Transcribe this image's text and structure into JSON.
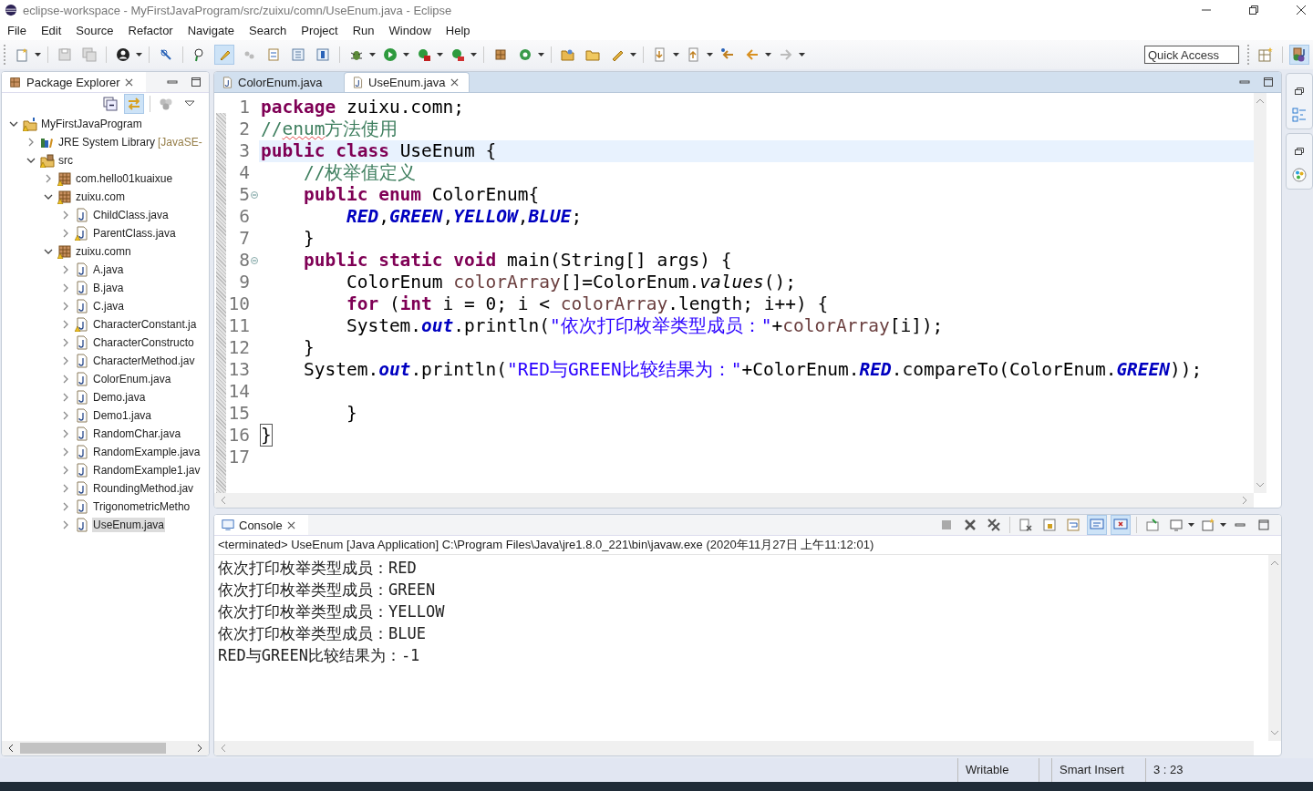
{
  "window": {
    "title": "eclipse-workspace - MyFirstJavaProgram/src/zuixu/comn/UseEnum.java - Eclipse"
  },
  "menu": [
    "File",
    "Edit",
    "Source",
    "Refactor",
    "Navigate",
    "Search",
    "Project",
    "Run",
    "Window",
    "Help"
  ],
  "quick_access": {
    "placeholder": "Quick Access"
  },
  "package_explorer": {
    "title": "Package Explorer",
    "tree": [
      {
        "label": "MyFirstJavaProgram",
        "kind": "project",
        "warning": true,
        "expanded": true,
        "selected": false,
        "children": [
          {
            "label": "JRE System Library",
            "decoration": "[JavaSE-",
            "kind": "library",
            "warning": false,
            "expanded": false,
            "selected": false
          },
          {
            "label": "src",
            "kind": "source-folder",
            "warning": true,
            "expanded": true,
            "selected": false,
            "children": [
              {
                "label": "com.hello01kuaixue",
                "kind": "package",
                "warning": true,
                "expanded": false,
                "selected": false
              },
              {
                "label": "zuixu.com",
                "kind": "package",
                "warning": true,
                "expanded": true,
                "selected": false,
                "children": [
                  {
                    "label": "ChildClass.java",
                    "kind": "java-file",
                    "warning": false,
                    "expanded": false,
                    "selected": false
                  },
                  {
                    "label": "ParentClass.java",
                    "kind": "java-file",
                    "warning": true,
                    "expanded": false,
                    "selected": false
                  }
                ]
              },
              {
                "label": "zuixu.comn",
                "kind": "package",
                "warning": true,
                "expanded": true,
                "selected": false,
                "children": [
                  {
                    "label": "A.java",
                    "kind": "java-file",
                    "warning": false,
                    "expanded": false,
                    "selected": false
                  },
                  {
                    "label": "B.java",
                    "kind": "java-file",
                    "warning": false,
                    "expanded": false,
                    "selected": false
                  },
                  {
                    "label": "C.java",
                    "kind": "java-file",
                    "warning": false,
                    "expanded": false,
                    "selected": false
                  },
                  {
                    "label": "CharacterConstant.ja",
                    "kind": "java-file",
                    "warning": true,
                    "expanded": false,
                    "selected": false
                  },
                  {
                    "label": "CharacterConstructo",
                    "kind": "java-file",
                    "warning": false,
                    "expanded": false,
                    "selected": false
                  },
                  {
                    "label": "CharacterMethod.jav",
                    "kind": "java-file",
                    "warning": false,
                    "expanded": false,
                    "selected": false
                  },
                  {
                    "label": "ColorEnum.java",
                    "kind": "java-file",
                    "warning": false,
                    "expanded": false,
                    "selected": false
                  },
                  {
                    "label": "Demo.java",
                    "kind": "java-file",
                    "warning": false,
                    "expanded": false,
                    "selected": false
                  },
                  {
                    "label": "Demo1.java",
                    "kind": "java-file",
                    "warning": false,
                    "expanded": false,
                    "selected": false
                  },
                  {
                    "label": "RandomChar.java",
                    "kind": "java-file",
                    "warning": false,
                    "expanded": false,
                    "selected": false
                  },
                  {
                    "label": "RandomExample.java",
                    "kind": "java-file",
                    "warning": false,
                    "expanded": false,
                    "selected": false
                  },
                  {
                    "label": "RandomExample1.jav",
                    "kind": "java-file",
                    "warning": false,
                    "expanded": false,
                    "selected": false
                  },
                  {
                    "label": "RoundingMethod.jav",
                    "kind": "java-file",
                    "warning": false,
                    "expanded": false,
                    "selected": false
                  },
                  {
                    "label": "TrigonometricMetho",
                    "kind": "java-file",
                    "warning": false,
                    "expanded": false,
                    "selected": false
                  },
                  {
                    "label": "UseEnum.java",
                    "kind": "java-file",
                    "warning": false,
                    "expanded": false,
                    "selected": true
                  }
                ]
              }
            ]
          }
        ]
      }
    ]
  },
  "editor": {
    "tabs": [
      {
        "label": "ColorEnum.java",
        "selected": false
      },
      {
        "label": "UseEnum.java",
        "selected": true
      }
    ],
    "lines": [
      {
        "number": "1",
        "current": false,
        "fold": false,
        "tokens": [
          {
            "kind": "keyword",
            "text": "package"
          },
          {
            "kind": "plain",
            "text": " zuixu.comn;"
          }
        ]
      },
      {
        "number": "2",
        "current": false,
        "fold": false,
        "tokens": [
          {
            "kind": "comment",
            "text": "//"
          },
          {
            "kind": "comment-misspelled",
            "text": "enum"
          },
          {
            "kind": "comment",
            "text": "方法使用"
          }
        ]
      },
      {
        "number": "3",
        "current": true,
        "fold": false,
        "tokens": [
          {
            "kind": "keyword",
            "text": "public class"
          },
          {
            "kind": "plain",
            "text": " UseEnum {"
          }
        ]
      },
      {
        "number": "4",
        "current": false,
        "fold": false,
        "tokens": [
          {
            "kind": "comment",
            "text": "    //枚举值定义"
          }
        ]
      },
      {
        "number": "5",
        "current": false,
        "fold": true,
        "tokens": [
          {
            "kind": "keyword",
            "text": "    public enum"
          },
          {
            "kind": "plain",
            "text": " ColorEnum{"
          }
        ]
      },
      {
        "number": "6",
        "current": false,
        "fold": false,
        "tokens": [
          {
            "kind": "field",
            "text": "        RED"
          },
          {
            "kind": "plain",
            "text": ","
          },
          {
            "kind": "field",
            "text": "GREEN"
          },
          {
            "kind": "plain",
            "text": ","
          },
          {
            "kind": "field",
            "text": "YELLOW"
          },
          {
            "kind": "plain",
            "text": ","
          },
          {
            "kind": "field",
            "text": "BLUE"
          },
          {
            "kind": "plain",
            "text": ";"
          }
        ]
      },
      {
        "number": "7",
        "current": false,
        "fold": false,
        "tokens": [
          {
            "kind": "plain",
            "text": "    }"
          }
        ]
      },
      {
        "number": "8",
        "current": false,
        "fold": true,
        "tokens": [
          {
            "kind": "keyword",
            "text": "    public static void"
          },
          {
            "kind": "plain",
            "text": " main(String[] args) {"
          }
        ]
      },
      {
        "number": "9",
        "current": false,
        "fold": false,
        "tokens": [
          {
            "kind": "plain",
            "text": "        ColorEnum "
          },
          {
            "kind": "variable",
            "text": "colorArray"
          },
          {
            "kind": "plain",
            "text": "[]=ColorEnum."
          },
          {
            "kind": "static-method",
            "text": "values"
          },
          {
            "kind": "plain",
            "text": "();"
          }
        ]
      },
      {
        "number": "10",
        "current": false,
        "fold": false,
        "tokens": [
          {
            "kind": "keyword",
            "text": "        for"
          },
          {
            "kind": "plain",
            "text": " ("
          },
          {
            "kind": "keyword",
            "text": "int"
          },
          {
            "kind": "plain",
            "text": " i = 0; i < "
          },
          {
            "kind": "variable",
            "text": "colorArray"
          },
          {
            "kind": "plain",
            "text": ".length; i++) {"
          }
        ]
      },
      {
        "number": "11",
        "current": false,
        "fold": false,
        "tokens": [
          {
            "kind": "plain",
            "text": "        System."
          },
          {
            "kind": "field",
            "text": "out"
          },
          {
            "kind": "plain",
            "text": ".println("
          },
          {
            "kind": "string",
            "text": "\"依次打印枚举类型成员：\""
          },
          {
            "kind": "plain",
            "text": "+"
          },
          {
            "kind": "variable",
            "text": "colorArray"
          },
          {
            "kind": "plain",
            "text": "[i]);"
          }
        ]
      },
      {
        "number": "12",
        "current": false,
        "fold": false,
        "tokens": [
          {
            "kind": "plain",
            "text": "    }"
          }
        ]
      },
      {
        "number": "13",
        "current": false,
        "fold": false,
        "tokens": [
          {
            "kind": "plain",
            "text": "    System."
          },
          {
            "kind": "field",
            "text": "out"
          },
          {
            "kind": "plain",
            "text": ".println("
          },
          {
            "kind": "string",
            "text": "\"RED与GREEN比较结果为：\""
          },
          {
            "kind": "plain",
            "text": "+ColorEnum."
          },
          {
            "kind": "field",
            "text": "RED"
          },
          {
            "kind": "plain",
            "text": ".compareTo(ColorEnum."
          },
          {
            "kind": "field",
            "text": "GREEN"
          },
          {
            "kind": "plain",
            "text": "));"
          }
        ]
      },
      {
        "number": "14",
        "current": false,
        "fold": false
      },
      {
        "number": "15",
        "current": false,
        "fold": false,
        "tokens": [
          {
            "kind": "plain",
            "text": "        }"
          }
        ]
      },
      {
        "number": "16",
        "current": false,
        "fold": false,
        "tokens": [
          {
            "kind": "bracket-match",
            "text": "}"
          }
        ]
      },
      {
        "number": "17",
        "current": false,
        "fold": false
      }
    ]
  },
  "console": {
    "title": "Console",
    "status": "<terminated> UseEnum [Java Application] C:\\Program Files\\Java\\jre1.8.0_221\\bin\\javaw.exe (2020年11月27日 上午11:12:01)",
    "output": [
      "依次打印枚举类型成员：RED",
      "依次打印枚举类型成员：GREEN",
      "依次打印枚举类型成员：YELLOW",
      "依次打印枚举类型成员：BLUE",
      "RED与GREEN比较结果为：-1"
    ]
  },
  "status_bar": [
    "Writable",
    "Smart Insert",
    "3 : 23"
  ]
}
